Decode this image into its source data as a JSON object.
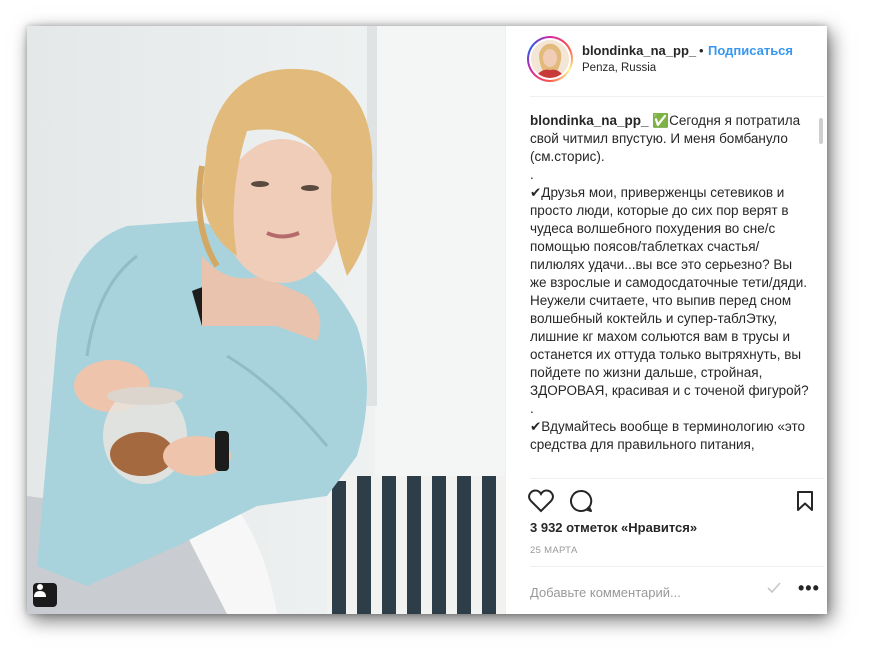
{
  "post": {
    "username": "blondinka_na_pp_",
    "separator": "•",
    "follow_label": "Подписаться",
    "location": "Penza, Russia",
    "caption_username": "blondinka_na_pp_",
    "caption_text": " ✅Сегодня я потратила свой читмил впустую. И меня бомбануло (см.сторис).\n.\n✔Друзья мои, приверженцы сетевиков и просто люди, которые до сих пор верят в чудеса волшебного похудения во сне/с помощью поясов/таблетках счастья/ пилюлях удачи...вы все это серьезно? Вы же взрослые и самодосдаточные тети/дяди. Неужели считаете, что выпив перед сном волшебный коктейль и супер-таблЭтку, лишние кг махом сольются вам в трусы  и останется  их оттуда только вытряхнуть, вы пойдете по жизни дальше, стройная, ЗДОРОВАЯ, красивая и с точеной фигурой?\n.\n✔Вдумайтесь вообще в терминологию «это средства для правильного питания,",
    "likes": "3 932 отметок «Нравится»",
    "date": "25 МАРТА",
    "comment_placeholder": "Добавьте комментарий...",
    "more_label": "•••"
  },
  "icons": {
    "like": "heart-icon",
    "comment": "comment-icon",
    "save": "bookmark-icon",
    "user_tag": "user-tag-icon",
    "post_comment": "send-icon"
  },
  "colors": {
    "link": "#3897f0",
    "sweater": "#a9d3dc",
    "hair": "#e2bb7c"
  }
}
